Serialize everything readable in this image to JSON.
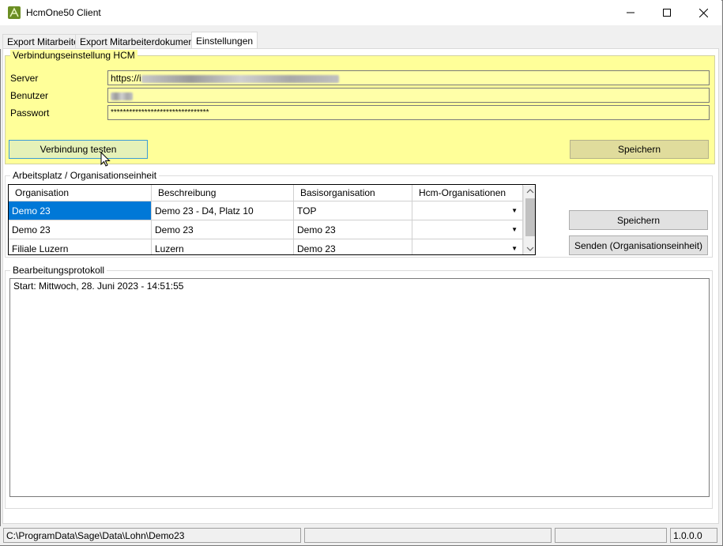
{
  "window": {
    "title": "HcmOne50 Client"
  },
  "tabs": [
    {
      "label": "Export Mitarbeiter"
    },
    {
      "label": "Export Mitarbeiterdokumente"
    },
    {
      "label": "Einstellungen"
    }
  ],
  "hcm": {
    "group_title": "Verbindungseinstellung HCM",
    "server_label": "Server",
    "server_value": "https://i",
    "user_label": "Benutzer",
    "password_label": "Passwort",
    "password_value": "********************************",
    "test_button": "Verbindung testen",
    "save_button": "Speichern"
  },
  "org": {
    "group_title": "Arbeitsplatz / Organisationseinheit",
    "columns": [
      "Organisation",
      "Beschreibung",
      "Basisorganisation",
      "Hcm-Organisationen"
    ],
    "rows": [
      [
        "Demo 23",
        "Demo 23 - D4, Platz 10",
        "TOP",
        ""
      ],
      [
        "Demo 23",
        "Demo 23",
        "Demo 23",
        ""
      ],
      [
        "Filiale Luzern",
        "Luzern",
        "Demo 23",
        ""
      ]
    ],
    "save_button": "Speichern",
    "send_button": "Senden (Organisationseinheit)"
  },
  "log": {
    "group_title": "Bearbeitungsprotokoll",
    "text": "Start: Mittwoch, 28. Juni 2023 - 14:51:55"
  },
  "status": {
    "path": "C:\\ProgramData\\Sage\\Data\\Lohn\\Demo23",
    "version": "1.0.0.0"
  },
  "colors": {
    "hcm_background": "#ffff99",
    "selection": "#0078d7"
  }
}
